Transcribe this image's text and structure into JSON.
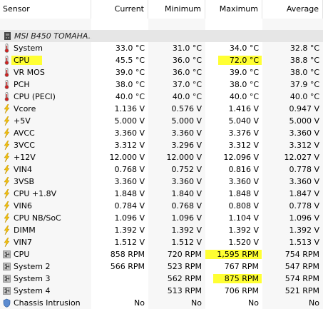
{
  "columns": {
    "sensor": "Sensor",
    "current": "Current",
    "minimum": "Minimum",
    "maximum": "Maximum",
    "average": "Average"
  },
  "device": {
    "name": "MSI B450 TOMAHA...",
    "icon": "motherboard-icon"
  },
  "rows": [
    {
      "name": "System",
      "icon": "thermometer-icon",
      "current": "33.0 °C",
      "minimum": "31.0 °C",
      "maximum": "34.0 °C",
      "average": "32.8 °C"
    },
    {
      "name": "CPU",
      "icon": "thermometer-icon",
      "current": "45.5 °C",
      "minimum": "36.0 °C",
      "maximum": "72.0 °C",
      "average": "38.8 °C",
      "highlight_name": true,
      "highlight_max": true
    },
    {
      "name": "VR MOS",
      "icon": "thermometer-icon",
      "current": "39.0 °C",
      "minimum": "36.0 °C",
      "maximum": "39.0 °C",
      "average": "38.0 °C"
    },
    {
      "name": "PCH",
      "icon": "thermometer-icon",
      "current": "38.0 °C",
      "minimum": "37.0 °C",
      "maximum": "38.0 °C",
      "average": "37.9 °C"
    },
    {
      "name": "CPU (PECI)",
      "icon": "thermometer-icon",
      "current": "40.0 °C",
      "minimum": "40.0 °C",
      "maximum": "40.0 °C",
      "average": "40.0 °C"
    },
    {
      "name": "Vcore",
      "icon": "lightning-icon",
      "current": "1.136 V",
      "minimum": "0.576 V",
      "maximum": "1.416 V",
      "average": "0.947 V"
    },
    {
      "name": "+5V",
      "icon": "lightning-icon",
      "current": "5.000 V",
      "minimum": "5.000 V",
      "maximum": "5.040 V",
      "average": "5.000 V"
    },
    {
      "name": "AVCC",
      "icon": "lightning-icon",
      "current": "3.360 V",
      "minimum": "3.360 V",
      "maximum": "3.376 V",
      "average": "3.360 V"
    },
    {
      "name": "3VCC",
      "icon": "lightning-icon",
      "current": "3.312 V",
      "minimum": "3.296 V",
      "maximum": "3.312 V",
      "average": "3.312 V"
    },
    {
      "name": "+12V",
      "icon": "lightning-icon",
      "current": "12.000 V",
      "minimum": "12.000 V",
      "maximum": "12.096 V",
      "average": "12.027 V"
    },
    {
      "name": "VIN4",
      "icon": "lightning-icon",
      "current": "0.768 V",
      "minimum": "0.752 V",
      "maximum": "0.816 V",
      "average": "0.778 V"
    },
    {
      "name": "3VSB",
      "icon": "lightning-icon",
      "current": "3.360 V",
      "minimum": "3.360 V",
      "maximum": "3.360 V",
      "average": "3.360 V"
    },
    {
      "name": "CPU +1.8V",
      "icon": "lightning-icon",
      "current": "1.848 V",
      "minimum": "1.840 V",
      "maximum": "1.848 V",
      "average": "1.847 V"
    },
    {
      "name": "VIN6",
      "icon": "lightning-icon",
      "current": "0.784 V",
      "minimum": "0.768 V",
      "maximum": "0.808 V",
      "average": "0.778 V"
    },
    {
      "name": "CPU NB/SoC",
      "icon": "lightning-icon",
      "current": "1.096 V",
      "minimum": "1.096 V",
      "maximum": "1.104 V",
      "average": "1.096 V"
    },
    {
      "name": "DIMM",
      "icon": "lightning-icon",
      "current": "1.392 V",
      "minimum": "1.392 V",
      "maximum": "1.392 V",
      "average": "1.392 V"
    },
    {
      "name": "VIN7",
      "icon": "lightning-icon",
      "current": "1.512 V",
      "minimum": "1.512 V",
      "maximum": "1.520 V",
      "average": "1.513 V"
    },
    {
      "name": "CPU",
      "icon": "fan-icon",
      "current": "858 RPM",
      "minimum": "720 RPM",
      "maximum": "1,595 RPM",
      "average": "754 RPM",
      "highlight_max": true
    },
    {
      "name": "System 2",
      "icon": "fan-icon",
      "current": "566 RPM",
      "minimum": "523 RPM",
      "maximum": "767 RPM",
      "average": "547 RPM"
    },
    {
      "name": "System 3",
      "icon": "fan-icon",
      "current": "",
      "minimum": "562 RPM",
      "maximum": "875 RPM",
      "average": "574 RPM",
      "highlight_max": true
    },
    {
      "name": "System 4",
      "icon": "fan-icon",
      "current": "",
      "minimum": "513 RPM",
      "maximum": "706 RPM",
      "average": "521 RPM"
    },
    {
      "name": "Chassis Intrusion",
      "icon": "shield-icon",
      "current": "No",
      "minimum": "No",
      "maximum": "No",
      "average": "No"
    }
  ],
  "colors": {
    "highlight": "#ffff33",
    "device_band": "#e6e6e6"
  }
}
